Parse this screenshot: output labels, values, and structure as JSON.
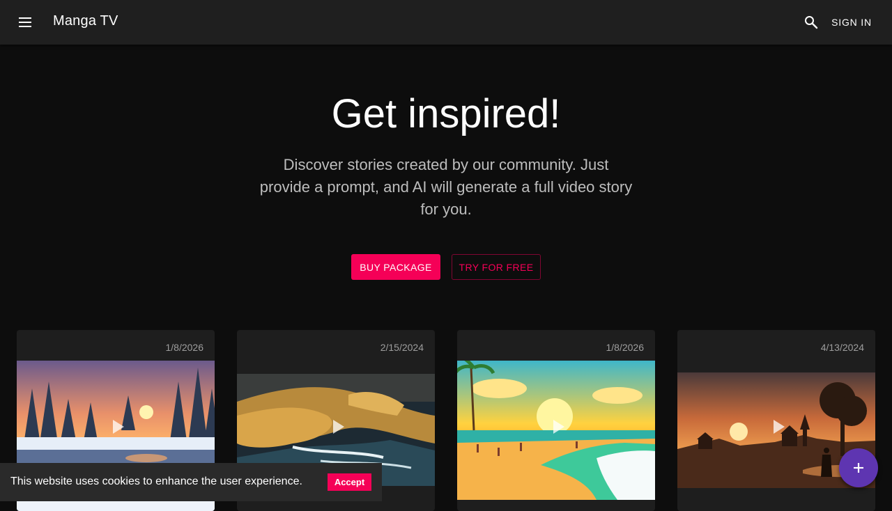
{
  "header": {
    "title": "Manga TV",
    "menu_icon": "menu-icon",
    "search_icon": "search-icon",
    "signin_label": "SIGN IN"
  },
  "hero": {
    "title": "Get inspired!",
    "subtitle": "Discover stories created by our community. Just provide a prompt, and AI will generate a full video story for you.",
    "buy_label": "BUY PACKAGE",
    "try_label": "TRY FOR FREE"
  },
  "cards": [
    {
      "date": "1/8/2026",
      "thumbnail": "snowy-forest-sunset"
    },
    {
      "date": "2/15/2024",
      "thumbnail": "rocky-coast-sunset"
    },
    {
      "date": "1/8/2026",
      "thumbnail": "tropical-beach-sun"
    },
    {
      "date": "4/13/2024",
      "thumbnail": "village-sunset-silhouette"
    }
  ],
  "cookie": {
    "text": "This website uses cookies to enhance the user experience.",
    "accept_label": "Accept"
  },
  "fab": {
    "icon": "plus-icon"
  },
  "colors": {
    "accent": "#f50057",
    "appbar": "#1f1f1f",
    "background": "#0d0d0d",
    "card": "#1e1e1e",
    "fab": "#5e35b1"
  }
}
